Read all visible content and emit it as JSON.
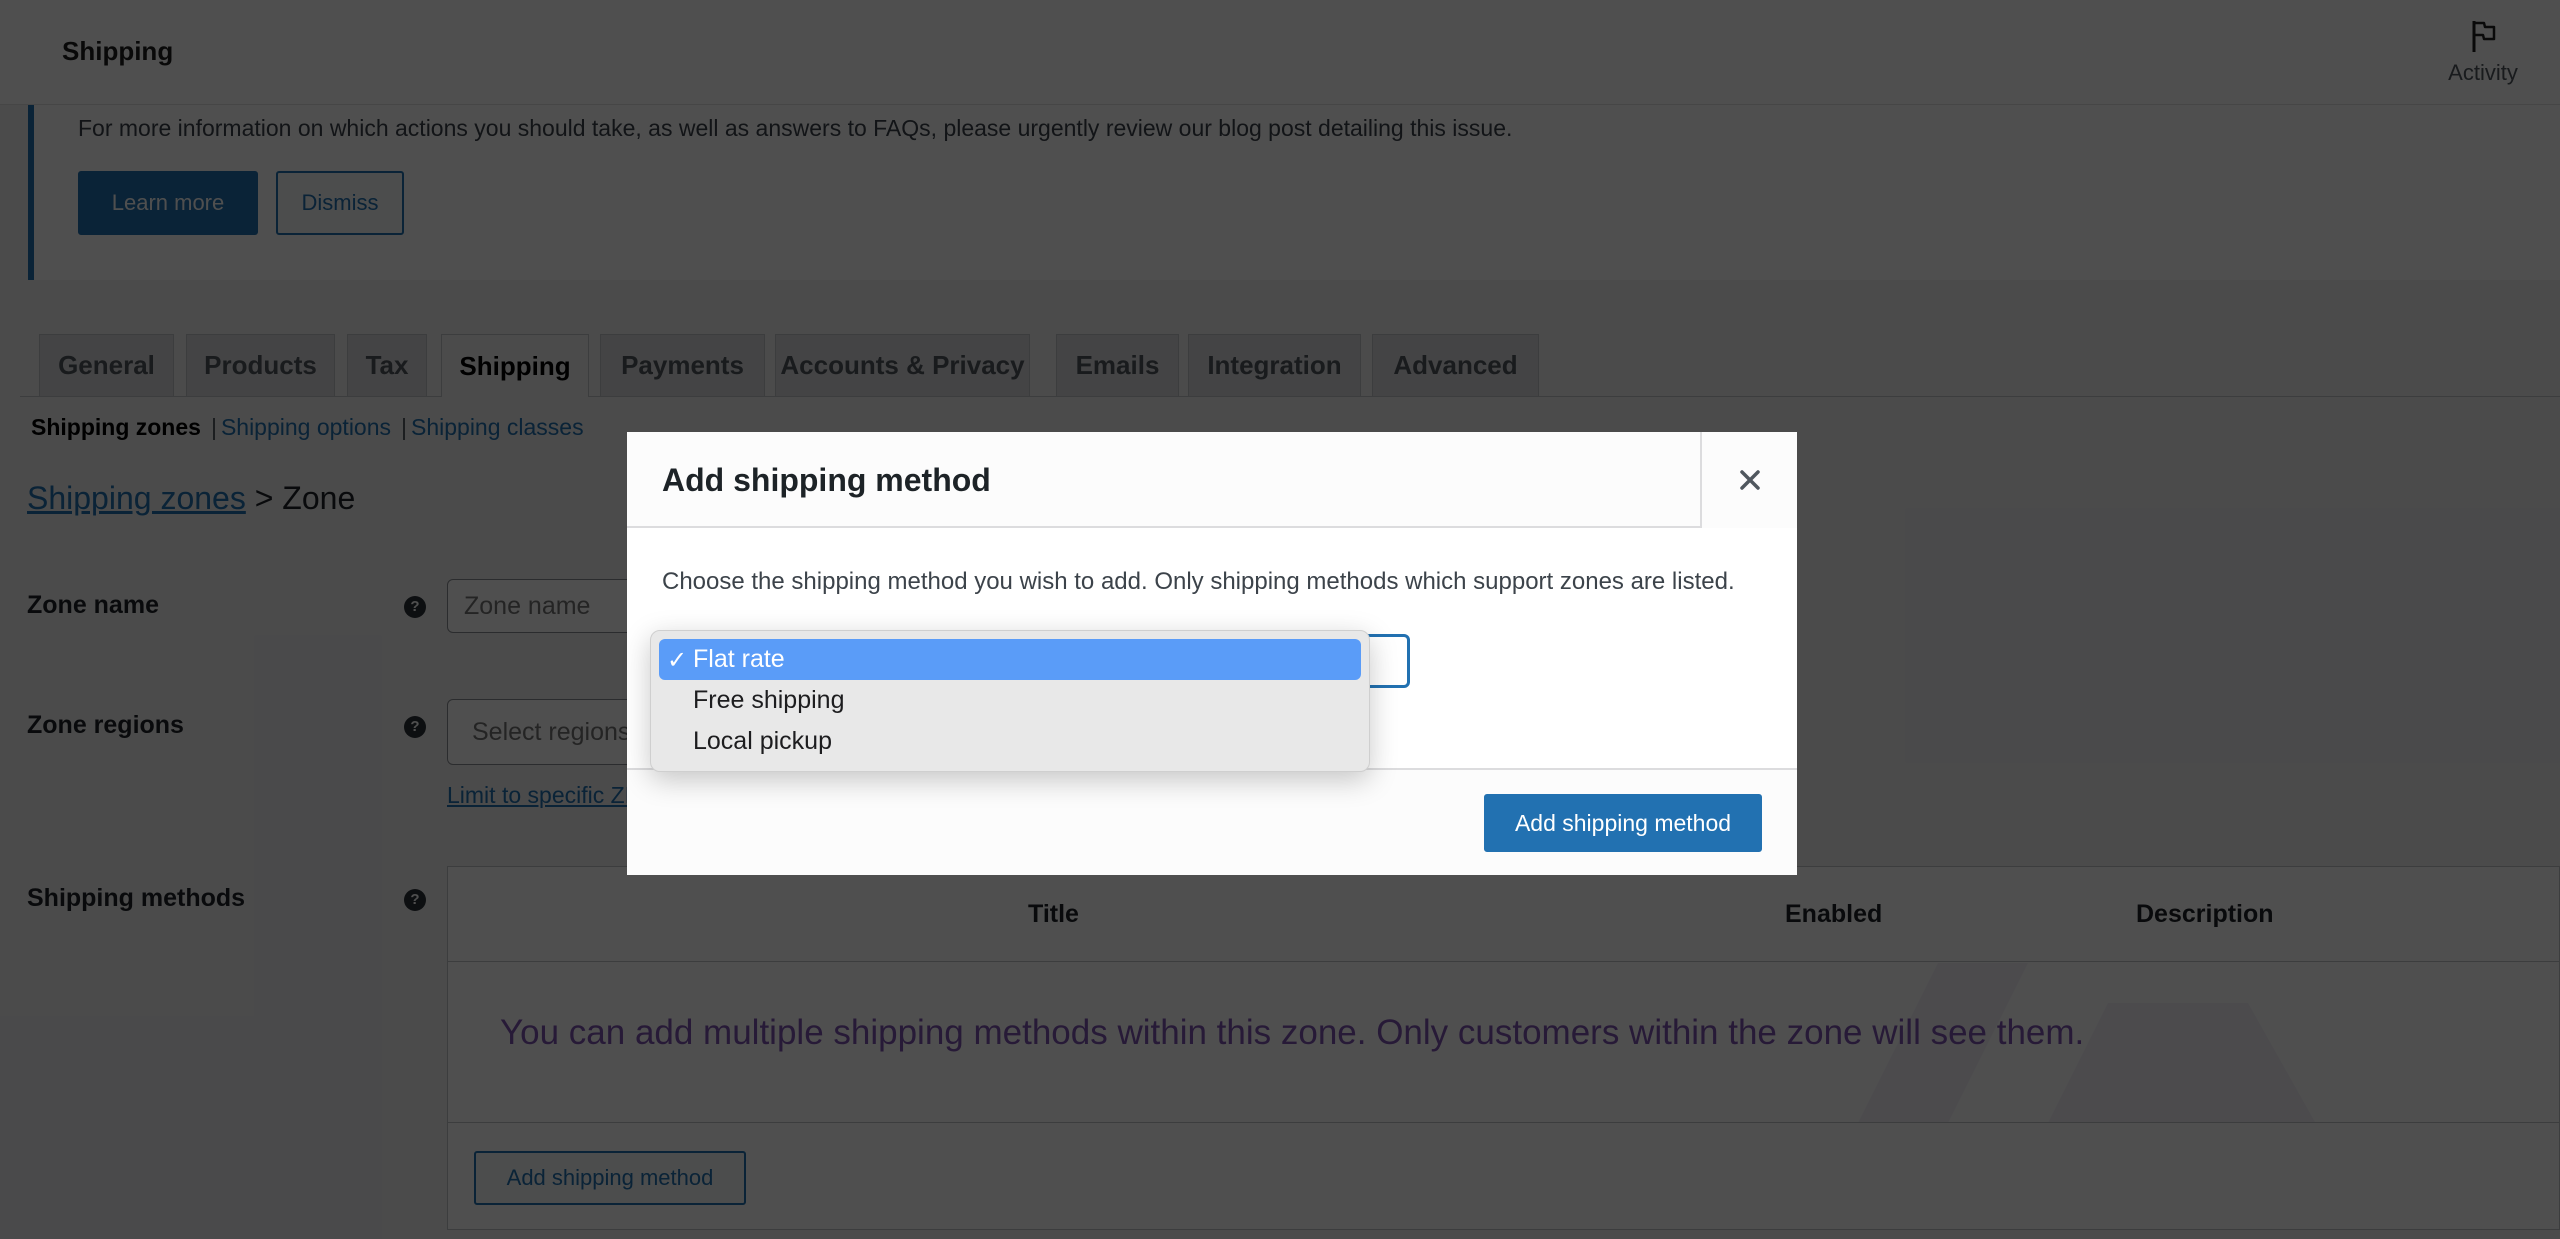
{
  "header": {
    "title": "Shipping",
    "activity_label": "Activity",
    "activity_icon": "flag-icon"
  },
  "notice": {
    "text": "For more information on which actions you should take, as well as answers to FAQs, please urgently review our blog post detailing this issue.",
    "learn_more_label": "Learn more",
    "dismiss_label": "Dismiss"
  },
  "tabs": [
    {
      "label": "General",
      "active": false
    },
    {
      "label": "Products",
      "active": false
    },
    {
      "label": "Tax",
      "active": false
    },
    {
      "label": "Shipping",
      "active": true
    },
    {
      "label": "Payments",
      "active": false
    },
    {
      "label": "Accounts & Privacy",
      "active": false
    },
    {
      "label": "Emails",
      "active": false
    },
    {
      "label": "Integration",
      "active": false
    },
    {
      "label": "Advanced",
      "active": false
    }
  ],
  "subnav": {
    "current": "Shipping zones",
    "links": [
      "Shipping options",
      "Shipping classes"
    ],
    "separator": "|"
  },
  "breadcrumb": {
    "link": "Shipping zones",
    "separator": ">",
    "current": "Zone"
  },
  "form": {
    "zone_name_label": "Zone name",
    "zone_name_placeholder": "Zone name",
    "zone_name_value": "",
    "zone_regions_label": "Zone regions",
    "zone_regions_placeholder": "Select regions within this zone",
    "limit_link": "Limit to specific ZIP/postcodes",
    "shipping_methods_label": "Shipping methods",
    "help_glyph": "?"
  },
  "methods_table": {
    "columns": [
      "Title",
      "Enabled",
      "Description"
    ],
    "empty_message": "You can add multiple shipping methods within this zone. Only customers within the zone will see them.",
    "add_button_label": "Add shipping method"
  },
  "modal": {
    "title": "Add shipping method",
    "close_glyph": "×",
    "description": "Choose the shipping method you wish to add. Only shipping methods which support zones are listed.",
    "select": {
      "selected": "Flat rate",
      "options": [
        "Flat rate",
        "Free shipping",
        "Local pickup"
      ],
      "check_glyph": "✓"
    },
    "submit_label": "Add shipping method"
  },
  "colors": {
    "accent": "#2271b1",
    "dropdown_highlight": "#5a9cf8",
    "empty_message": "#7f54b3",
    "overlay": "rgba(0,0,0,0.69)"
  }
}
